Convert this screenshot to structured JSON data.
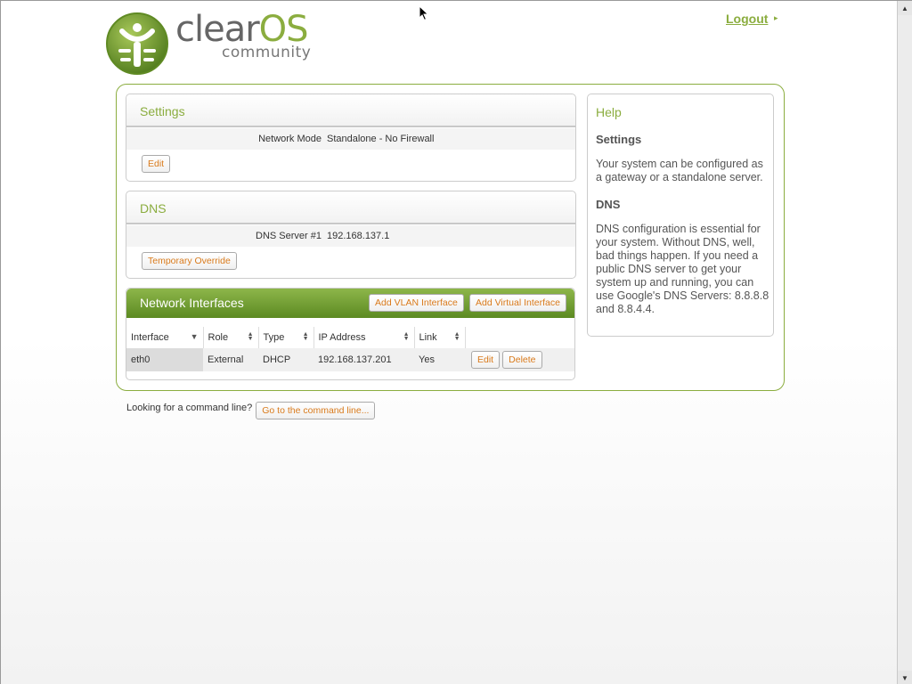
{
  "header": {
    "logo_word": "clear",
    "logo_word_os": "OS",
    "logo_sub": "community",
    "logout": "Logout",
    "logout_arrow": "▸"
  },
  "settings": {
    "title": "Settings",
    "network_mode_label": "Network Mode",
    "network_mode_value": "Standalone - No Firewall",
    "edit_button": "Edit"
  },
  "dns": {
    "title": "DNS",
    "server_label": "DNS Server #1",
    "server_value": "192.168.137.1",
    "override_button": "Temporary Override"
  },
  "interfaces": {
    "title": "Network Interfaces",
    "add_vlan_button": "Add VLAN Interface",
    "add_virtual_button": "Add Virtual Interface",
    "columns": [
      "Interface",
      "Role",
      "Type",
      "IP Address",
      "Link"
    ],
    "rows": [
      {
        "interface": "eth0",
        "role": "External",
        "type": "DHCP",
        "ip": "192.168.137.201",
        "link": "Yes",
        "edit": "Edit",
        "delete": "Delete"
      }
    ]
  },
  "help": {
    "title": "Help",
    "sections": [
      {
        "heading": "Settings",
        "text": "Your system can be configured as a gateway or a standalone server."
      },
      {
        "heading": "DNS",
        "text": "DNS configuration is essential for your system. Without DNS, well, bad things happen. If you need a public DNS server to get your system up and running, you can use Google's DNS Servers: 8.8.8.8 and 8.8.4.4."
      }
    ]
  },
  "footer": {
    "cmdline_text": "Looking for a command line?",
    "cmdline_button": "Go to the command line..."
  },
  "scrollbar": {
    "up_arrow": "▲",
    "down_arrow": "▼"
  },
  "colors": {
    "accent": "#8bad3f",
    "button_text": "#d97a1b",
    "ni_header_top": "#8db64a",
    "ni_header_bottom": "#5c8a22"
  }
}
